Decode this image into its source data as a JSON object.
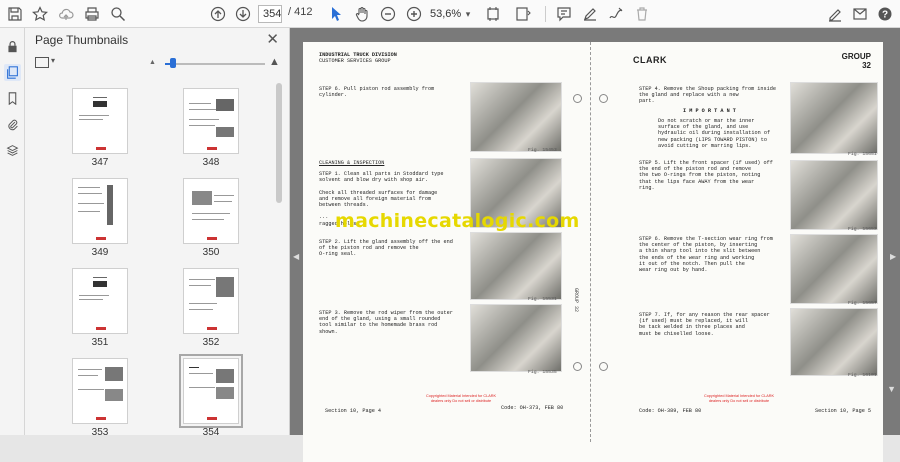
{
  "toolbar": {
    "page_current": "354",
    "page_total": "/ 412",
    "zoom": "53,6%"
  },
  "panel": {
    "title": "Page Thumbnails",
    "thumbnails": [
      {
        "label": "347"
      },
      {
        "label": "348"
      },
      {
        "label": "349"
      },
      {
        "label": "350"
      },
      {
        "label": "351"
      },
      {
        "label": "352"
      },
      {
        "label": "353"
      },
      {
        "label": "354"
      }
    ]
  },
  "document": {
    "left_page": {
      "header_line1": "INDUSTRIAL TRUCK DIVISION",
      "header_line2": "CUSTOMER SERVICES GROUP",
      "step6": "STEP 6.   Pull piston rod assembly from\n          cylinder.",
      "fig_a": "Fig. 15453",
      "section_heading": "CLEANING & INSPECTION",
      "step1": "STEP 1.   Clean all parts in Stoddard type\n          solvent and blow dry with shop air.\n\n          Check all threaded surfaces for damage\n          and remove all foreign material from\n          between threads.\n\n          ...\n          ragged holes.",
      "step2": "STEP 2.   Lift the gland assembly off the end\n          of the piston rod and remove the\n          O-ring seal.",
      "fig_b": "Fig. 15531",
      "step3": "STEP 3.   Remove the rod wiper from the outer\n          end of the gland, using a small rounded\n          tool similar to the homemade brass rod\n          shown.",
      "fig_c": "Fig. 15535",
      "footer_left": "Section 10, Page 4",
      "footer_code": "Code: OH-373, FEB 80"
    },
    "right_page": {
      "brand": "CLARK",
      "group_label": "GROUP",
      "group_num": "32",
      "step4": "STEP 4.   Remove the Shoup packing from inside\n          the gland and replace with a new\n          part.",
      "important": "I M P O R T A N T",
      "important_text": "Do not scratch or mar the inner\nsurface of the gland, and use\nhydraulic oil during installation of\nnew packing (LIPS TOWARD PISTON) to\navoid cutting or marring lips.",
      "fig_d": "Fig. 15651",
      "step5": "STEP 5.   Lift the front spacer (if used) off\n          the end of the piston rod and remove\n          the two O-rings from the piston, noting\n          that the lips face AWAY from the wear\n          ring.",
      "fig_e": "Fig. 15653",
      "step6": "STEP 6.   Remove the T-section wear ring from\n          the center of the piston, by inserting\n          a thin sharp tool into the slit between\n          the ends of the wear ring and working\n          it out of the notch.  Then pull the\n          wear ring out by hand.",
      "fig_f": "Fig. 15657",
      "step7": "STEP 7.   If, for any reason the rear spacer\n          (if used) must be replaced, it will\n          be tack welded in three places and\n          must be chiselled loose.",
      "fig_g": "Fig. 16101",
      "footer_code": "Code: OH-389, FEB 80",
      "footer_right": "Section 10, Page 5"
    },
    "watermark": "machinecatalogic.com",
    "copyright": "Copyrighted Material\nIntended for CLARK dealers only\nDo not sell or distribute",
    "side_binding": "GROUP 32"
  }
}
